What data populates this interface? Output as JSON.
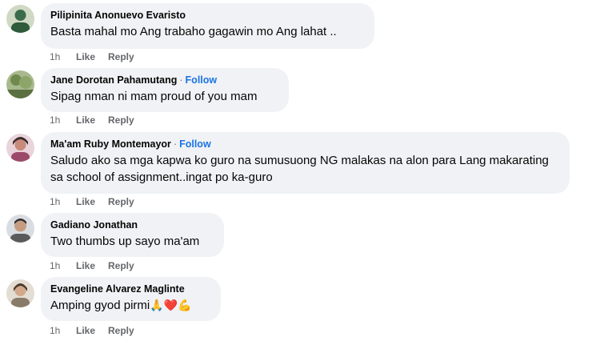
{
  "comments": [
    {
      "author": "Pilipinita Anonuevo Evaristo",
      "follow": "",
      "text": "Basta mahal mo Ang trabaho gagawin mo Ang lahat ..",
      "time": "1h",
      "like": "Like",
      "reply": "Reply",
      "avatar_color": "#3a6b4a"
    },
    {
      "author": "Jane Dorotan Pahamutang",
      "separator": "·",
      "follow": "Follow",
      "text": "Sipag nman ni mam proud of you mam",
      "time": "1h",
      "like": "Like",
      "reply": "Reply",
      "avatar_color": "#7b8f5e"
    },
    {
      "author": "Ma'am Ruby Montemayor",
      "separator": "·",
      "follow": "Follow",
      "text": "Saludo ako sa mga kapwa ko guro na sumusuong NG malakas na alon para Lang makarating sa school of assignment..ingat po ka-guro",
      "time": "1h",
      "like": "Like",
      "reply": "Reply",
      "avatar_color": "#9c4a6a"
    },
    {
      "author": "Gadiano Jonathan",
      "follow": "",
      "text": "Two thumbs up sayo ma'am",
      "time": "1h",
      "like": "Like",
      "reply": "Reply",
      "avatar_color": "#5a5a5a"
    },
    {
      "author": "Evangeline Alvarez Maglinte",
      "follow": "",
      "text": "Amping gyod pirmi",
      "emojis": [
        "🙏",
        "❤️",
        "💪"
      ],
      "time": "1h",
      "like": "Like",
      "reply": "Reply",
      "avatar_color": "#8a7a6a"
    }
  ],
  "colors": {
    "bubble": "#f0f2f5",
    "link": "#1b74e4",
    "meta": "#65676b"
  }
}
